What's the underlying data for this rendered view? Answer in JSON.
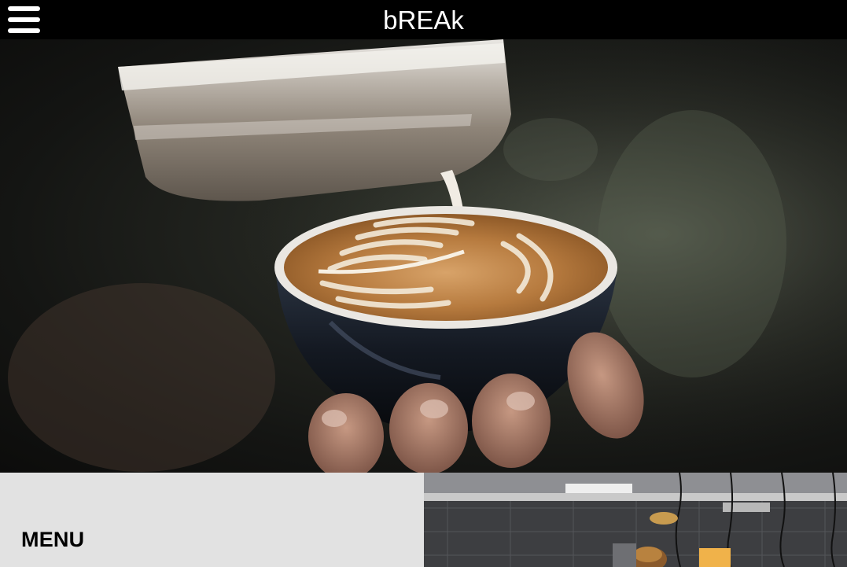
{
  "header": {
    "brand": "bREAk",
    "menu_icon": "hamburger-menu-icon"
  },
  "hero": {
    "image": "latte-art-pour-photo"
  },
  "sections": [
    {
      "title": "MENU",
      "image": "kitchen-counter-photo"
    }
  ],
  "colors": {
    "header_bg": "#000000",
    "brand_text": "#ffffff",
    "menu_panel_bg": "#e2e2e2",
    "menu_title_text": "#000000"
  }
}
